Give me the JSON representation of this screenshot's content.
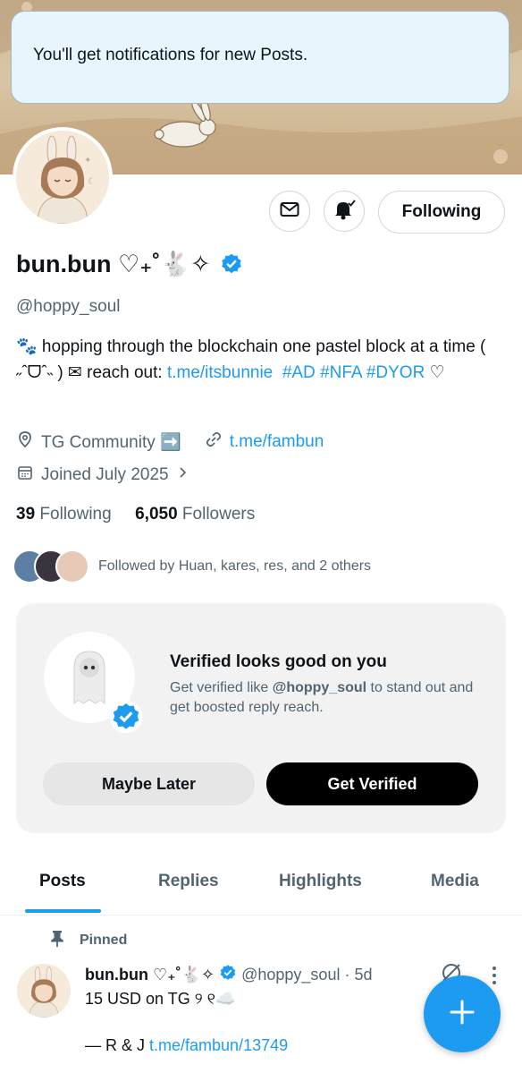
{
  "toast": {
    "text": "You'll get notifications for new Posts."
  },
  "profile": {
    "name": "bun.bun ♡₊˚🐇✧",
    "handle": "@hoppy_soul",
    "bio_prefix": "🐾 hopping through the blockchain one pastel block at a time ( ˶ˆᗜˆ˵ ) ✉ reach out: ",
    "bio_link": "t.me/itsbunnie",
    "bio_tags": [
      "#AD",
      "#NFA",
      "#DYOR"
    ],
    "bio_suffix": "♡",
    "location": "TG Community ➡️",
    "website": "t.me/fambun",
    "joined": "Joined July 2025",
    "following_count": "39",
    "following_label": "Following",
    "followers_count": "6,050",
    "followers_label": "Followers",
    "followed_by": "Followed by Huan, kares, res, and 2 others"
  },
  "actions": {
    "following_button": "Following"
  },
  "verify_card": {
    "title": "Verified looks good on you",
    "text_prefix": "Get verified like ",
    "text_handle": "@hoppy_soul",
    "text_suffix": " to stand out and get boosted reply reach.",
    "later_label": "Maybe Later",
    "verify_label": "Get Verified"
  },
  "tabs": [
    {
      "label": "Posts"
    },
    {
      "label": "Replies"
    },
    {
      "label": "Highlights"
    },
    {
      "label": "Media"
    }
  ],
  "post": {
    "pinned_label": "Pinned",
    "name": "bun.bun ♡₊˚🐇✧",
    "handle": "@hoppy_soul",
    "time": "· 5d",
    "line1": "15 USD on TG ୨ ୧☁️",
    "line2_prefix": "— R & J ",
    "line2_link": "t.me/fambun/13749"
  },
  "colors": {
    "accent": "#1d9bf0",
    "secondary_text": "#536471",
    "toast_bg": "#e8f5fd"
  }
}
